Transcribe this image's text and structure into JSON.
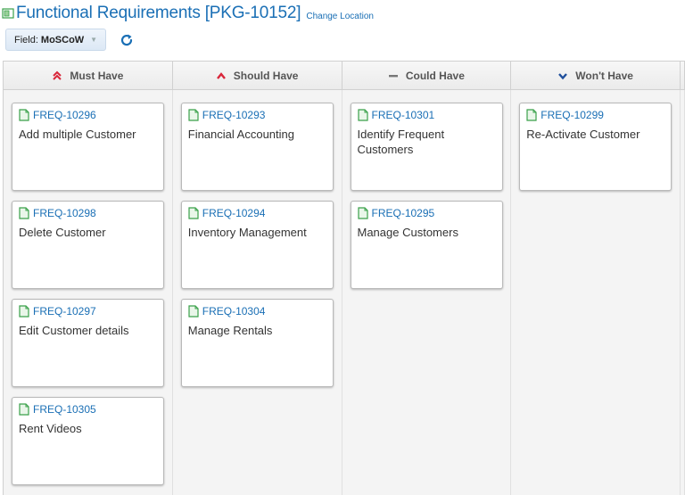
{
  "header": {
    "title": "Functional Requirements [PKG-10152]",
    "change_location": "Change Location"
  },
  "toolbar": {
    "field_label": "Field:",
    "field_value": "MoSCoW"
  },
  "columns": [
    {
      "label": "Must Have",
      "icon": "double-chevron-up-icon",
      "icon_color": "#d9263a"
    },
    {
      "label": "Should Have",
      "icon": "chevron-up-icon",
      "icon_color": "#d9263a"
    },
    {
      "label": "Could Have",
      "icon": "dash-icon",
      "icon_color": "#777777"
    },
    {
      "label": "Won't Have",
      "icon": "chevron-down-icon",
      "icon_color": "#1f4f9c"
    }
  ],
  "cards": {
    "must": [
      {
        "id": "FREQ-10296",
        "title": "Add multiple Customer"
      },
      {
        "id": "FREQ-10298",
        "title": "Delete Customer"
      },
      {
        "id": "FREQ-10297",
        "title": "Edit Customer details"
      },
      {
        "id": "FREQ-10305",
        "title": "Rent Videos"
      }
    ],
    "should": [
      {
        "id": "FREQ-10293",
        "title": "Financial Accounting"
      },
      {
        "id": "FREQ-10294",
        "title": "Inventory Management"
      },
      {
        "id": "FREQ-10304",
        "title": "Manage Rentals"
      }
    ],
    "could": [
      {
        "id": "FREQ-10301",
        "title": "Identify Frequent Customers"
      },
      {
        "id": "FREQ-10295",
        "title": "Manage Customers"
      }
    ],
    "wont": [
      {
        "id": "FREQ-10299",
        "title": "Re-Activate Customer"
      }
    ]
  },
  "colors": {
    "link": "#1a6fb5",
    "doc_icon": "#3aa14a"
  }
}
